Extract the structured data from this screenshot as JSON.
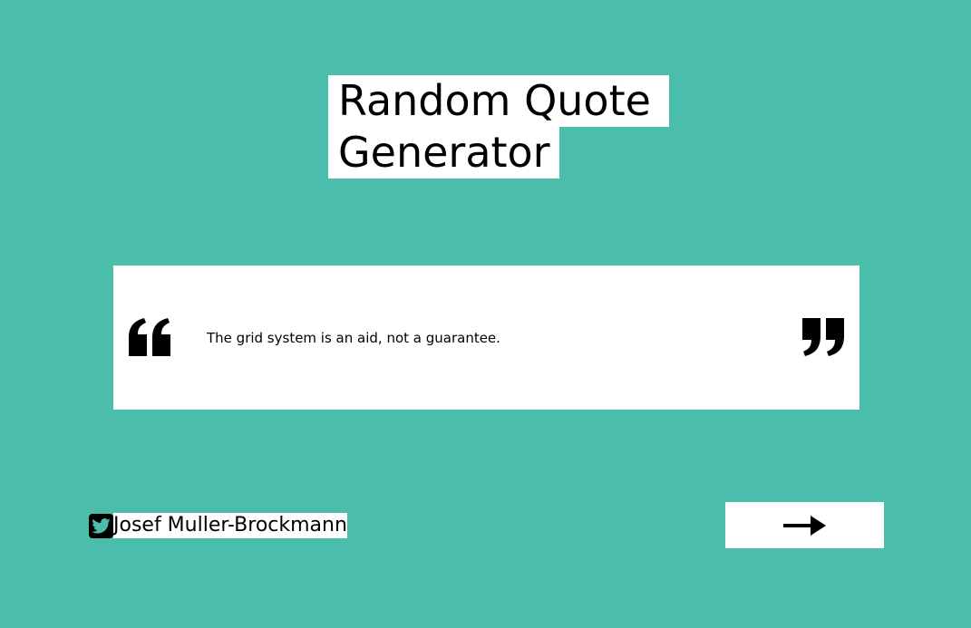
{
  "header": {
    "title_line1": "Random Quote",
    "title_line2": "Generator"
  },
  "quote": {
    "text": "The grid system is an aid, not a guarantee.",
    "open_icon": "quote-left-icon",
    "close_icon": "quote-right-icon"
  },
  "author": {
    "name": "Josef Muller-Brockmann",
    "share_icon": "twitter-icon"
  },
  "next": {
    "icon": "arrow-right-icon"
  },
  "colors": {
    "background": "#4bbdab",
    "panel": "#ffffff",
    "text": "#000000"
  }
}
